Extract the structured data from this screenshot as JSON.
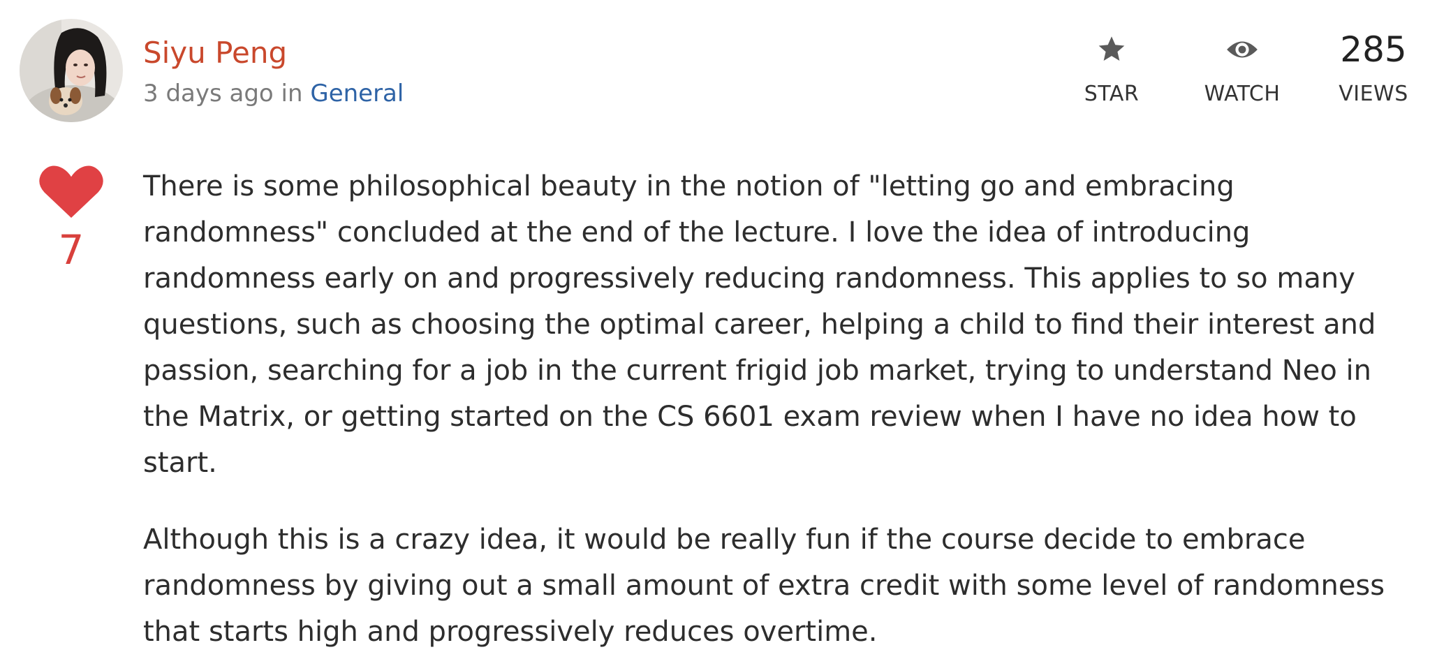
{
  "author": {
    "name": "Siyu Peng",
    "time_ago": "3 days ago",
    "in_word": "in",
    "category": "General"
  },
  "stats": {
    "star_icon": "star-icon",
    "star_label": "STAR",
    "watch_icon": "eye-icon",
    "watch_label": "WATCH",
    "views_count": "285",
    "views_label": "VIEWS"
  },
  "like": {
    "icon": "heart-icon",
    "count": "7",
    "color": "#e04144"
  },
  "colors": {
    "author_name": "#c9482c",
    "category_link": "#2e63a6",
    "meta_text": "#7a7a7a",
    "icon_gray": "#5a5a5a"
  },
  "content": {
    "paragraphs": [
      "There is some philosophical beauty in the notion of \"letting go and embracing randomness\" concluded at the end of the lecture. I love the idea of introducing randomness early on and progressively reducing randomness. This applies to so many questions, such as choosing the optimal career, helping a child to find their interest and passion, searching for a job in the current frigid job market, trying to understand Neo in the Matrix, or getting started on the CS 6601 exam review when I have no idea how to start.",
      "Although this is a crazy idea, it would be really fun if the course decide to embrace randomness by giving out a small amount of extra credit with some level of randomness that starts high and progressively reduces overtime."
    ]
  }
}
